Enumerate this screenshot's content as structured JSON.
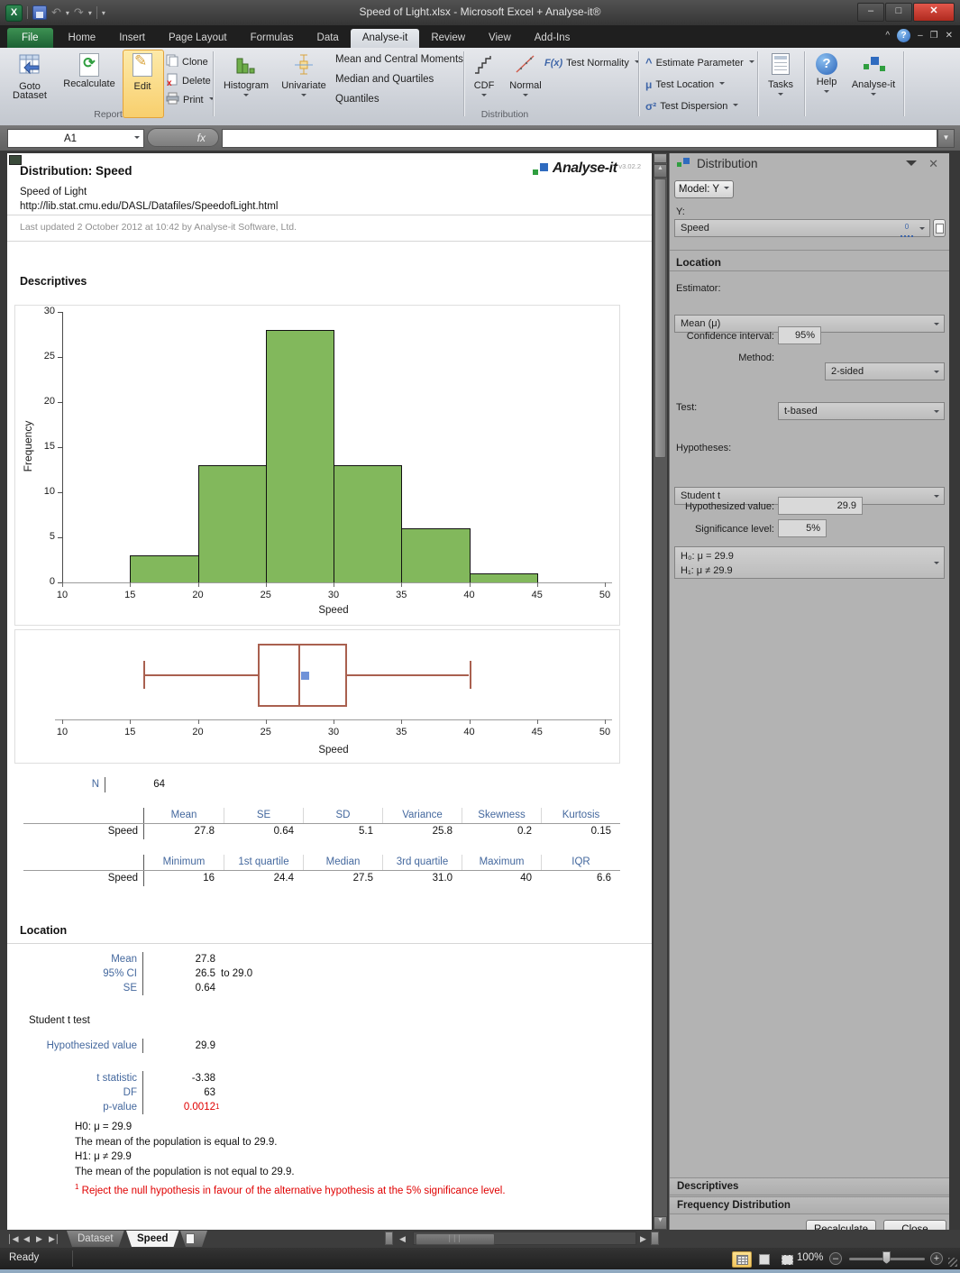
{
  "window": {
    "title": "Speed of Light.xlsx  -  Microsoft Excel + Analyse-it®"
  },
  "icons": {
    "fx_button": "F(x)",
    "mu": "μ",
    "sigma": "σ²",
    "caret": "^",
    "formula_fx": "fx",
    "zero": "0",
    "help_q": "?"
  },
  "ribbon": {
    "tabs": [
      "File",
      "Home",
      "Insert",
      "Page Layout",
      "Formulas",
      "Data",
      "Analyse-it",
      "Review",
      "View",
      "Add-Ins"
    ],
    "goto1": "Goto",
    "goto2": "Dataset",
    "recalculate": "Recalculate",
    "edit": "Edit",
    "clone": "Clone",
    "delete": "Delete",
    "print": "Print",
    "report_group": "Report",
    "histogram": "Histogram",
    "univariate": "Univariate",
    "menu1": "Mean and Central Moments",
    "menu2": "Median and Quartiles",
    "menu3": "Quantiles",
    "cdf": "CDF",
    "normal": "Normal",
    "test_normality": "Test Normality",
    "estimate_parameter": "Estimate Parameter",
    "test_location": "Test Location",
    "test_dispersion": "Test Dispersion",
    "distribution_group": "Distribution",
    "tasks": "Tasks",
    "help": "Help",
    "analyseit": "Analyse-it"
  },
  "formula_bar": {
    "name_box": "A1"
  },
  "report": {
    "title": "Distribution: Speed",
    "subtitle": "Speed of Light",
    "url": "http://lib.stat.cmu.edu/DASL/Datafiles/SpeedofLight.html",
    "updated": "Last updated 2 October 2012 at 10:42 by Analyse-it Software, Ltd.",
    "brand": "Analyse-it",
    "brand_version": "v3.02.2",
    "descriptives_heading": "Descriptives",
    "n_label": "N",
    "n_value": "64",
    "moments_table": {
      "row_label": "Speed",
      "headers": [
        "Mean",
        "SE",
        "SD",
        "Variance",
        "Skewness",
        "Kurtosis"
      ],
      "values": [
        "27.8",
        "0.64",
        "5.1",
        "25.8",
        "0.2",
        "0.15"
      ]
    },
    "quartiles_table": {
      "row_label": "Speed",
      "headers": [
        "Minimum",
        "1st quartile",
        "Median",
        "3rd quartile",
        "Maximum",
        "IQR"
      ],
      "values": [
        "16",
        "24.4",
        "27.5",
        "31.0",
        "40",
        "6.6"
      ]
    },
    "location_heading": "Location",
    "location_stats": [
      {
        "label": "Mean",
        "value": "27.8",
        "suffix": ""
      },
      {
        "label": "95% CI",
        "value": "26.5",
        "suffix": "to 29.0"
      },
      {
        "label": "SE",
        "value": "0.64",
        "suffix": ""
      }
    ],
    "test_name": "Student t test",
    "hyp_row": {
      "label": "Hypothesized value",
      "value": "29.9"
    },
    "test_stats": [
      {
        "label": "t statistic",
        "value": "-3.38"
      },
      {
        "label": "DF",
        "value": "63"
      }
    ],
    "p_label": "p-value",
    "p_value": "0.0012",
    "p_sup": "1",
    "hypothesis_lines": [
      "H0: μ = 29.9",
      "The mean of the population is equal to 29.9.",
      "H1: μ ≠ 29.9",
      "The mean of the population is not equal to 29.9."
    ],
    "footnote_sup": "1",
    "footnote": "Reject the null hypothesis in favour of the alternative hypothesis at the 5% significance level."
  },
  "chart_data": [
    {
      "type": "bar",
      "subtype": "histogram",
      "title": "",
      "xlabel": "Speed",
      "ylabel": "Frequency",
      "xlim": [
        10,
        50
      ],
      "ylim": [
        0,
        30
      ],
      "x_ticks": [
        10,
        15,
        20,
        25,
        30,
        35,
        40,
        45,
        50
      ],
      "y_ticks": [
        0,
        5,
        10,
        15,
        20,
        25,
        30
      ],
      "bins": [
        {
          "x0": 15,
          "x1": 20,
          "count": 3
        },
        {
          "x0": 20,
          "x1": 25,
          "count": 13
        },
        {
          "x0": 25,
          "x1": 30,
          "count": 28
        },
        {
          "x0": 30,
          "x1": 35,
          "count": 13
        },
        {
          "x0": 35,
          "x1": 40,
          "count": 6
        },
        {
          "x0": 40,
          "x1": 45,
          "count": 1
        }
      ],
      "bar_color": "#82b85c",
      "bar_border": "#111111",
      "grid": false,
      "legend": false
    },
    {
      "type": "boxplot",
      "xlabel": "Speed",
      "xlim": [
        10,
        50
      ],
      "x_ticks": [
        10,
        15,
        20,
        25,
        30,
        35,
        40,
        45,
        50
      ],
      "whisker_min": 16,
      "q1": 24.4,
      "median": 27.5,
      "q3": 31.0,
      "whisker_max": 40,
      "mean": 27.8,
      "line_color": "#a9604f",
      "mean_color": "#7092d8"
    }
  ],
  "panel": {
    "title": "Distribution",
    "model_button": "Model: Y",
    "y_label": "Y:",
    "y_value": "Speed",
    "location_section": "Location",
    "estimator_label": "Estimator:",
    "estimator_value": "Mean (μ)",
    "ci_label": "Confidence interval:",
    "ci_value": "95%",
    "ci_side": "2-sided",
    "method_label": "Method:",
    "method_value": "t-based",
    "test_label": "Test:",
    "test_value": "Student t",
    "hypotheses_label": "Hypotheses:",
    "h0": "H₀: μ = 29.9",
    "h1": "H₁: μ ≠ 29.9",
    "hyp_value_label": "Hypothesized value:",
    "hyp_value": "29.9",
    "sig_label": "Significance level:",
    "sig_value": "5%",
    "sections": [
      "Descriptives",
      "Frequency Distribution"
    ],
    "recalculate": "Recalculate",
    "close": "Close"
  },
  "sheet_tabs": {
    "dataset": "Dataset",
    "speed": "Speed"
  },
  "status": {
    "ready": "Ready",
    "zoom": "100%"
  }
}
